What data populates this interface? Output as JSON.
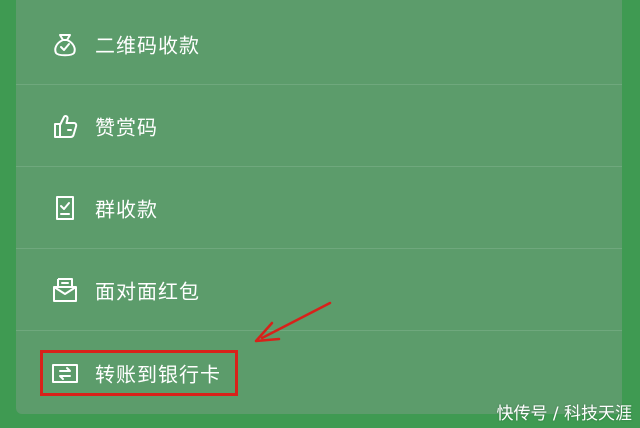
{
  "menu": {
    "items": [
      {
        "label": "二维码收款",
        "icon": "money-bag-icon"
      },
      {
        "label": "赞赏码",
        "icon": "thumbs-up-icon"
      },
      {
        "label": "群收款",
        "icon": "group-receipt-icon"
      },
      {
        "label": "面对面红包",
        "icon": "red-envelope-icon"
      },
      {
        "label": "转账到银行卡",
        "icon": "bank-transfer-icon"
      }
    ]
  },
  "watermark": "快传号 / 科技天涯",
  "colors": {
    "background": "#3f9a52",
    "panel": "#5c9c6b",
    "text": "#ffffff",
    "annotation_red": "#d8211a"
  }
}
